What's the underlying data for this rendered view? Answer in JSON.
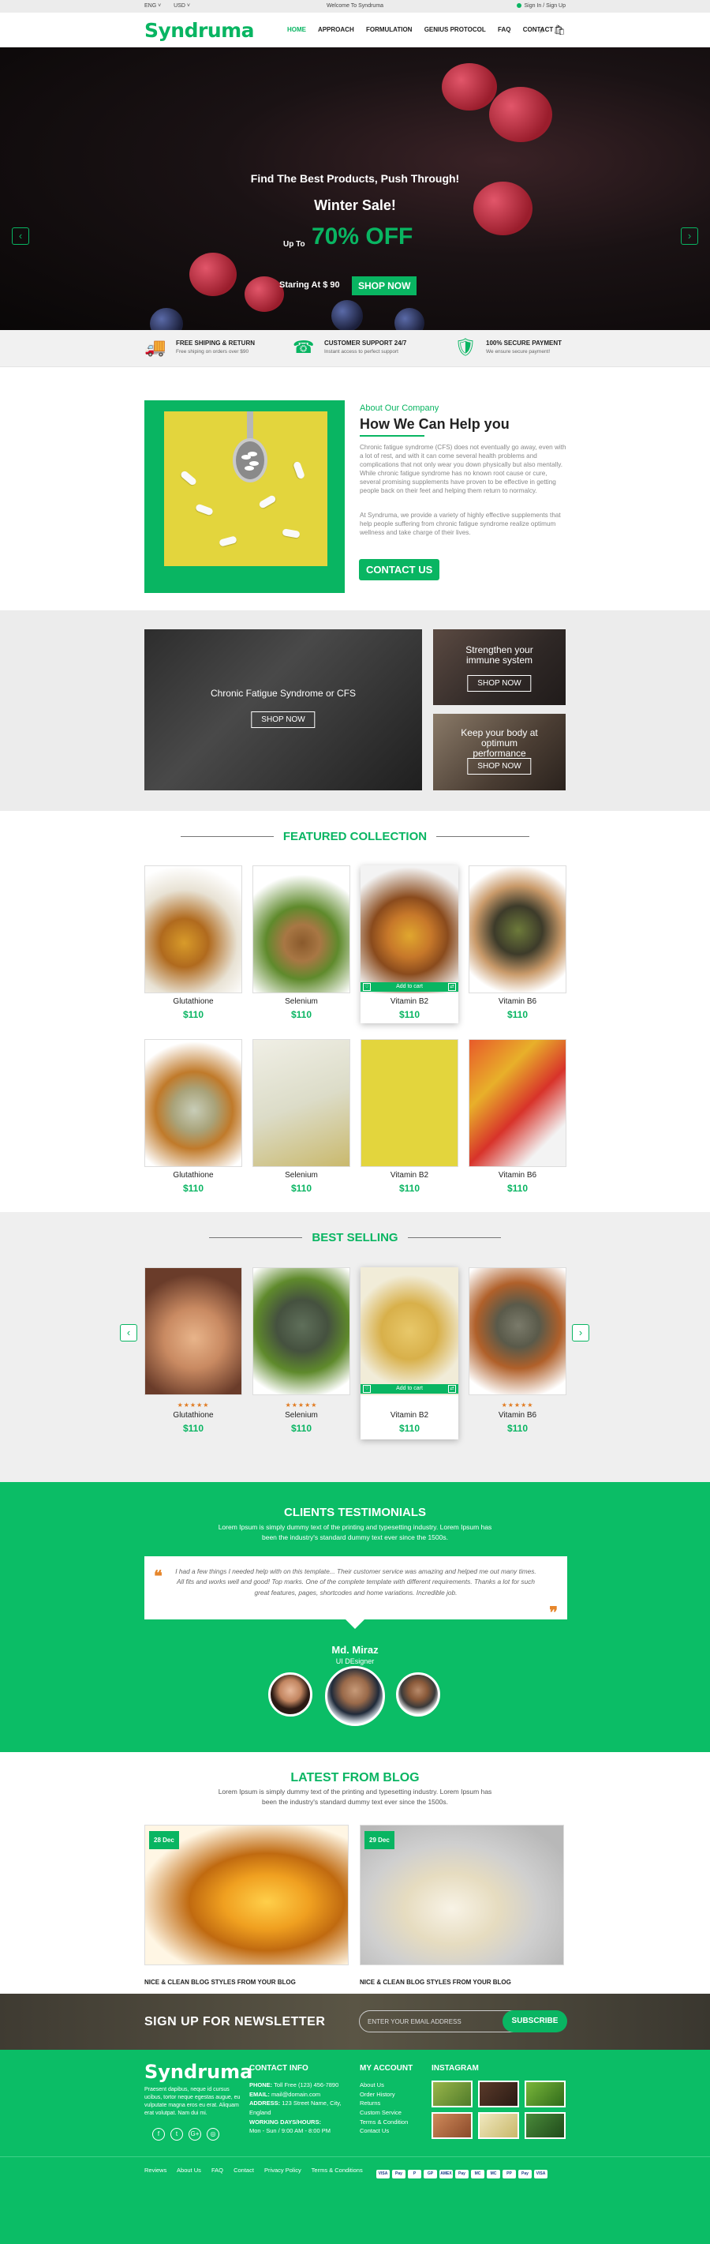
{
  "topbar": {
    "lang": "ENG ˅",
    "currency": "USD ˅",
    "welcome": "Welcome To Syndruma",
    "signin": "Sign In / Sign Up"
  },
  "header": {
    "logo": "Syndruma",
    "nav": [
      "HOME",
      "APPROACH",
      "FORMULATION",
      "GENIUS PROTOCOL",
      "FAQ",
      "CONTACT"
    ],
    "search_icon": "⌕",
    "cart_icon": "🛍"
  },
  "hero": {
    "line1": "Find The Best Products, Push Through!",
    "line2": "Winter Sale!",
    "upto": "Up To",
    "discount": "70% OFF",
    "starting": "Staring At $ 90",
    "cta": "SHOP NOW",
    "prev": "‹",
    "next": "›"
  },
  "features": [
    {
      "icon": "truck-icon",
      "glyph": "🚚",
      "title": "FREE SHIPING & RETURN",
      "sub": "Free shiping on orders over $90"
    },
    {
      "icon": "support-icon",
      "glyph": "☎",
      "title": "CUSTOMER SUPPORT 24/7",
      "sub": "Instant access to perfect support"
    },
    {
      "icon": "secure-icon",
      "glyph": "🛡",
      "title": "100% SECURE PAYMENT",
      "sub": "We ensure secure payment!"
    }
  ],
  "about": {
    "subtitle": "About Our Company",
    "title": "How We Can Help you",
    "p1": "Chronic fatigue syndrome (CFS) does not eventually go away, even with a lot of rest, and with it can come several health problems and complications that not only wear you down physically but also mentally. While chronic fatigue syndrome has no known root cause or cure, several promising supplements have proven to be effective in getting people back on their feet and helping them return to normalcy.",
    "p2": "At Syndruma, we provide a variety of highly effective supplements that help people suffering from chronic fatigue syndrome realize optimum wellness and take charge of their lives.",
    "cta": "CONTACT US"
  },
  "promo": {
    "big": {
      "title": "Chronic Fatigue Syndrome or CFS",
      "cta": "SHOP NOW"
    },
    "small1": {
      "title": "Strengthen your immune system",
      "cta": "SHOP NOW"
    },
    "small2": {
      "title": "Keep your body at optimum performance",
      "cta": "SHOP NOW"
    }
  },
  "featured": {
    "title": "FEATURED COLLECTION",
    "add_to_cart": "Add to cart",
    "products": [
      {
        "name": "Glutathione",
        "price": "$110"
      },
      {
        "name": "Selenium",
        "price": "$110"
      },
      {
        "name": "Vitamin B2",
        "price": "$110"
      },
      {
        "name": "Vitamin B6",
        "price": "$110"
      },
      {
        "name": "Glutathione",
        "price": "$110"
      },
      {
        "name": "Selenium",
        "price": "$110"
      },
      {
        "name": "Vitamin B2",
        "price": "$110"
      },
      {
        "name": "Vitamin B6",
        "price": "$110"
      }
    ]
  },
  "bestselling": {
    "title": "BEST SELLING",
    "add_to_cart": "Add to cart",
    "stars": "★★★★★",
    "products": [
      {
        "name": "Glutathione",
        "price": "$110"
      },
      {
        "name": "Selenium",
        "price": "$110"
      },
      {
        "name": "Vitamin B2",
        "price": "$110"
      },
      {
        "name": "Vitamin B6",
        "price": "$110"
      }
    ],
    "prev": "‹",
    "next": "›"
  },
  "testimonials": {
    "title": "CLIENTS TESTIMONIALS",
    "subtitle": "Lorem Ipsum is simply dummy text of the printing and typesetting industry. Lorem Ipsum has been the industry's standard dummy text ever since the 1500s.",
    "quote": "I had a few things I needed help with on this template... Their customer service was amazing and helped me out many times. All fits and works well and good! Top marks. One of the complete template with different requirements. Thanks a lot for such great features, pages, shortcodes and home variations. Incredible job.",
    "name": "Md. Miraz",
    "role": "UI DEsigner"
  },
  "blog": {
    "title": "LATEST FROM BLOG",
    "subtitle": "Lorem Ipsum is simply dummy text of the printing and typesetting industry. Lorem Ipsum has been the industry's standard dummy text ever since the 1500s.",
    "posts": [
      {
        "date": "28 Dec",
        "caption": "NICE & CLEAN BLOG STYLES FROM YOUR BLOG"
      },
      {
        "date": "29 Dec",
        "caption": "NICE & CLEAN BLOG STYLES FROM YOUR BLOG"
      }
    ]
  },
  "newsletter": {
    "title": "SIGN UP FOR NEWSLETTER",
    "placeholder": "ENTER YOUR EMAIL ADDRESS",
    "cta": "SUBSCRIBE"
  },
  "footer": {
    "logo": "Syndruma",
    "desc": "Praesent dapibus, neque id cursus ucibus, tortor neque egestas augue, eu vulputate magna eros eu erat. Aliquam erat volutpat. Nam dui mi.",
    "contact_title": "CONTACT INFO",
    "phone_label": "PHONE:",
    "phone": "Toll Free (123) 456-7890",
    "email_label": "EMAIL:",
    "email": "mail@domain.com",
    "address_label": "ADDRESS:",
    "address": "123 Street Name, City, England",
    "hours_label": "WORKING DAYS/HOURS:",
    "hours": "Mon - Sun / 9:00 AM - 8:00 PM",
    "account_title": "MY ACCOUNT",
    "account_links": [
      "About Us",
      "Order History",
      "Returns",
      "Custom Service",
      "Terms & Condition",
      "Contact Us"
    ],
    "instagram_title": "INSTAGRAM",
    "social": [
      "f",
      "t",
      "G+",
      "◎"
    ]
  },
  "bottom": {
    "links": [
      "Reviews",
      "About Us",
      "FAQ",
      "Contact",
      "Privacy Policy",
      "Terms & Conditions"
    ],
    "payments": [
      "VISA",
      "Pay",
      "P",
      "GP",
      "AMEX",
      "Pay",
      "MC",
      "MC",
      "PP",
      "Pay",
      "VISA"
    ]
  },
  "colors": {
    "accent": "#09b562",
    "footer": "#0bbd66",
    "star": "#e07a20"
  }
}
